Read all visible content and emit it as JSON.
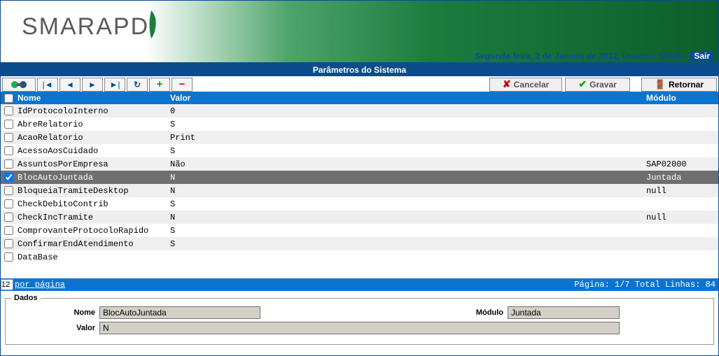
{
  "brand": "SMARAPD",
  "status": {
    "text": "Segunda-feira, 2 de Janeiro de 2012, Usuário: SMAR",
    "exit": "Sair"
  },
  "window_title": "Parâmetros do Sistema",
  "toolbar": {
    "search_icon": "search",
    "first": "|◄",
    "prev": "◄",
    "next": "►",
    "last": "►|",
    "refresh": "↻",
    "add": "+",
    "remove": "−",
    "cancel": "Cancelar",
    "save": "Gravar",
    "return": "Retornar"
  },
  "grid": {
    "headers": {
      "nome": "Nome",
      "valor": "Valor",
      "modulo": "Módulo"
    },
    "rows": [
      {
        "checked": false,
        "nome": "IdProtocoloInterno",
        "valor": "0",
        "modulo": ""
      },
      {
        "checked": false,
        "nome": "AbreRelatorio",
        "valor": "S",
        "modulo": ""
      },
      {
        "checked": false,
        "nome": "AcaoRelatorio",
        "valor": "Print",
        "modulo": ""
      },
      {
        "checked": false,
        "nome": "AcessoAosCuidado",
        "valor": "S",
        "modulo": ""
      },
      {
        "checked": false,
        "nome": "AssuntosPorEmpresa",
        "valor": "Não",
        "modulo": "SAP02000"
      },
      {
        "checked": true,
        "nome": "BlocAutoJuntada",
        "valor": "N",
        "modulo": "Juntada",
        "selected": true
      },
      {
        "checked": false,
        "nome": "BloqueiaTramiteDesktop",
        "valor": "N",
        "modulo": "null"
      },
      {
        "checked": false,
        "nome": "CheckDebitoContrib",
        "valor": "S",
        "modulo": ""
      },
      {
        "checked": false,
        "nome": "CheckIncTramite",
        "valor": "N",
        "modulo": "null"
      },
      {
        "checked": false,
        "nome": "ComprovanteProtocoloRapido",
        "valor": "S",
        "modulo": ""
      },
      {
        "checked": false,
        "nome": "ConfirmarEndAtendimento",
        "valor": "S",
        "modulo": ""
      },
      {
        "checked": false,
        "nome": "DataBase",
        "valor": "",
        "modulo": ""
      }
    ]
  },
  "pager": {
    "per_page_value": "12",
    "per_page_label": "por página",
    "info": "Página: 1/7 Total Linhas: 84"
  },
  "form": {
    "legend": "Dados",
    "labels": {
      "nome": "Nome",
      "modulo": "Módulo",
      "valor": "Valor"
    },
    "values": {
      "nome": "BlocAutoJuntada",
      "modulo": "Juntada",
      "valor": "N"
    }
  }
}
